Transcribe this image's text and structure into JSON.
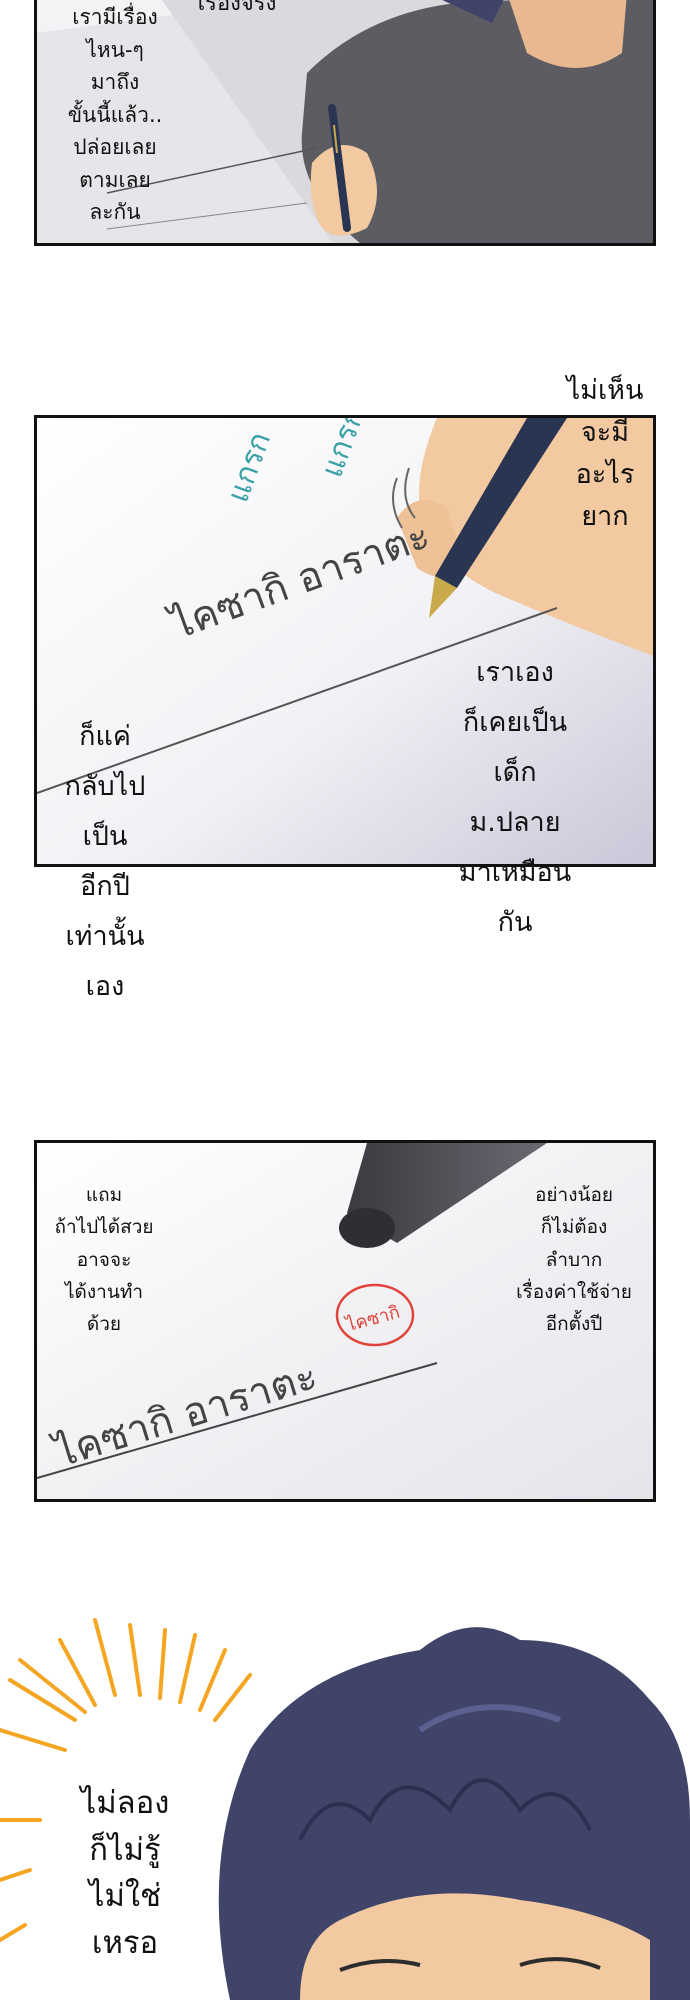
{
  "panel1": {
    "caption_lines": [
      "เรามีเรื่อง",
      "ไหน-ๆ",
      "มาถึง",
      "ขั้นนี้แล้ว..",
      "ปล่อยเลย",
      "ตามเลย",
      "ละกัน"
    ],
    "top_text": "เรื่องจริง"
  },
  "panel2": {
    "outside_text_lines": [
      "ไม่เห็น",
      "จะมี",
      "อะไร",
      "ยาก"
    ],
    "sfx_1": "แกรก",
    "sfx_2": "แกรก",
    "signature": "ไคซากิ อาราตะ",
    "bubble_right_lines": [
      "เราเอง",
      "ก็เคยเป็น",
      "เด็ก",
      "ม.ปลาย",
      "มาเหมือน",
      "กัน"
    ],
    "bubble_left_lines": [
      "ก็แค่",
      "กลับไป",
      "เป็น",
      "อีกปี",
      "เท่านั้น",
      "เอง"
    ]
  },
  "panel3": {
    "left_text_lines": [
      "แถม",
      "ถ้าไปได้สวย",
      "อาจจะ",
      "ได้งานทำ",
      "ด้วย"
    ],
    "right_text_lines": [
      "อย่างน้อย",
      "ก็ไม่ต้อง",
      "ลำบาก",
      "เรื่องค่าใช้จ่าย",
      "อีกตั้งปี"
    ],
    "stamp": "ไคซากิ",
    "signature": "ไคซากิ อาราตะ"
  },
  "panel4": {
    "text_lines": [
      "ไม่ลอง",
      "ก็ไม่รู้",
      "ไม่ใช่",
      "เหรอ"
    ]
  },
  "colors": {
    "hair": "#3f4468",
    "skin": "#f2c9a0",
    "sweater": "#5c5c62",
    "pen": "#2a3552",
    "sfx": "#3aa0a8",
    "stamp": "#e0433a",
    "burst": "#f4a623"
  }
}
